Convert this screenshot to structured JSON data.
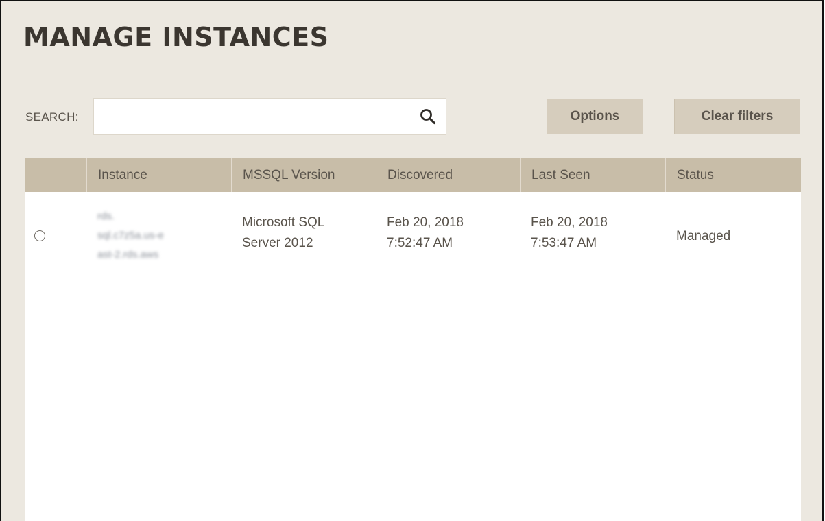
{
  "page": {
    "title": "MANAGE INSTANCES"
  },
  "search": {
    "label": "SEARCH:",
    "value": "",
    "placeholder": "",
    "icon": "search-icon"
  },
  "toolbar": {
    "options_label": "Options",
    "clear_filters_label": "Clear filters"
  },
  "table": {
    "columns": {
      "instance": "Instance",
      "version": "MSSQL Version",
      "discovered": "Discovered",
      "last_seen": "Last Seen",
      "status": "Status"
    },
    "rows": [
      {
        "selected": false,
        "instance_lines": [
          "rds.",
          "sql.c7z5a.us-e",
          "ast-2.rds.aws"
        ],
        "version_lines": [
          "Microsoft SQL",
          "Server 2012"
        ],
        "discovered_lines": [
          "Feb 20, 2018",
          "7:52:47 AM"
        ],
        "last_seen_lines": [
          "Feb 20, 2018",
          "7:53:47 AM"
        ],
        "status": "Managed"
      }
    ]
  },
  "colors": {
    "background": "#ece8e0",
    "header": "#c8bda8",
    "button": "#d6cdbd",
    "text": "#5a544c",
    "title": "#3b3630"
  }
}
